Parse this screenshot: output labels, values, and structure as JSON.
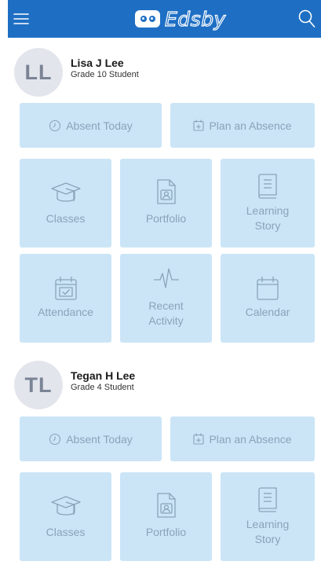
{
  "app": {
    "brand_name": "Edsby",
    "colors": {
      "topbar": "#1e6fc4",
      "tile": "#cbe5f7",
      "tile_text": "#8aa3b8",
      "avatar_bg": "#e3e5ec"
    }
  },
  "header": {
    "menu_icon": "hamburger-menu-icon",
    "search_icon": "search-icon"
  },
  "students": [
    {
      "initials": "LL",
      "name": "Lisa J Lee",
      "grade": "Grade 10 Student",
      "actions": {
        "absent_today": "Absent Today",
        "plan_absence": "Plan an Absence"
      },
      "tiles": {
        "classes": "Classes",
        "portfolio": "Portfolio",
        "learning_story_1": "Learning",
        "learning_story_2": "Story",
        "attendance": "Attendance",
        "recent_activity_1": "Recent",
        "recent_activity_2": "Activity",
        "calendar": "Calendar"
      }
    },
    {
      "initials": "TL",
      "name": "Tegan H Lee",
      "grade": "Grade 4 Student",
      "actions": {
        "absent_today": "Absent Today",
        "plan_absence": "Plan an Absence"
      },
      "tiles": {
        "classes": "Classes",
        "portfolio": "Portfolio",
        "learning_story_1": "Learning",
        "learning_story_2": "Story"
      }
    }
  ]
}
